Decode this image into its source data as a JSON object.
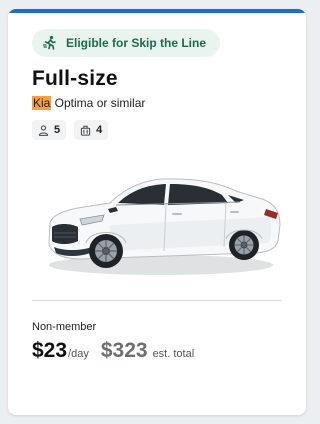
{
  "card": {
    "accent_color": "#1f6fb2",
    "badge": {
      "icon": "running-person-icon",
      "label": "Eligible for Skip the Line",
      "color": "#1d6b4f",
      "background": "#e9f4ef"
    },
    "title": "Full-size",
    "subtitle": {
      "brand": "Kia",
      "model": " Optima or similar"
    },
    "features": [
      {
        "icon": "person-icon",
        "value": "5"
      },
      {
        "icon": "luggage-icon",
        "value": "4"
      }
    ],
    "image": {
      "icon": "white-sedan-car-image"
    },
    "pricing": {
      "member_label": "Non-member",
      "daily_price": "$23",
      "daily_unit": "/day",
      "total_price": "$323",
      "total_unit": "est. total"
    }
  }
}
